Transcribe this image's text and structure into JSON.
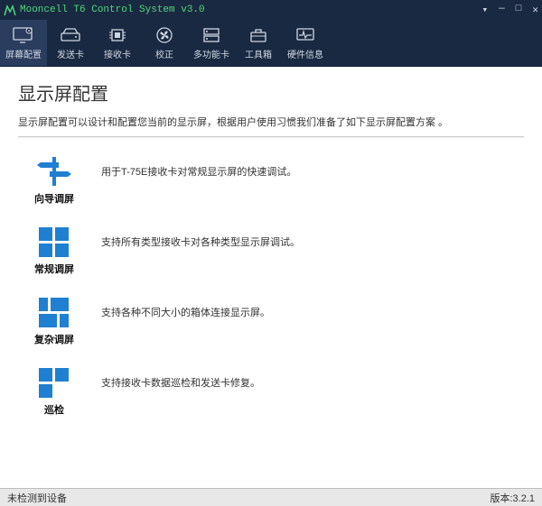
{
  "titlebar": {
    "text": "Mooncell T6 Control System v3.0"
  },
  "toolbar": {
    "tabs": [
      {
        "label": "屏幕配置"
      },
      {
        "label": "发送卡"
      },
      {
        "label": "接收卡"
      },
      {
        "label": "校正"
      },
      {
        "label": "多功能卡"
      },
      {
        "label": "工具箱"
      },
      {
        "label": "硬件信息"
      }
    ]
  },
  "page": {
    "title": "显示屏配置",
    "desc": "显示屏配置可以设计和配置您当前的显示屏，根据用户使用习惯我们准备了如下显示屏配置方案 。"
  },
  "options": [
    {
      "label": "向导调屏",
      "desc": "用于T-75E接收卡对常规显示屏的快速调试。"
    },
    {
      "label": "常规调屏",
      "desc": "支持所有类型接收卡对各种类型显示屏调试。"
    },
    {
      "label": "复杂调屏",
      "desc": "支持各种不同大小的箱体连接显示屏。"
    },
    {
      "label": "巡检",
      "desc": "支持接收卡数据巡检和发送卡修复。"
    }
  ],
  "status": {
    "left": "未检测到设备",
    "right": "版本:3.2.1"
  }
}
